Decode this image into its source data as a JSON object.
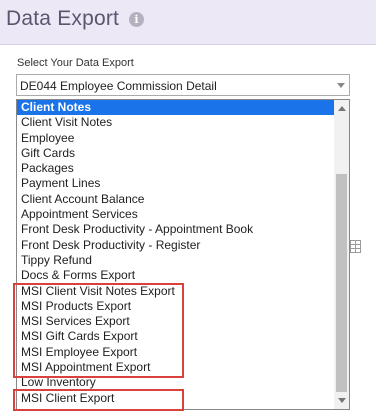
{
  "header": {
    "title": "Data Export",
    "info_icon": "info-icon"
  },
  "export_select": {
    "label": "Select Your Data Export",
    "value": "DE044 Employee Commission Detail"
  },
  "dropdown": {
    "selected_index": 0,
    "scroll_position": 0.25,
    "options": [
      "Client Notes",
      "Client Visit Notes",
      "Employee",
      "Gift Cards",
      "Packages",
      "Payment Lines",
      "Client Account Balance",
      "Appointment Services",
      "Front Desk Productivity - Appointment Book",
      "Front Desk Productivity - Register",
      "Tippy Refund",
      "Docs & Forms Export",
      "MSI Client Visit Notes Export",
      "MSI Products Export",
      "MSI Services Export",
      "MSI Gift Cards Export",
      "MSI Employee Export",
      "MSI Appointment Export",
      "Low Inventory",
      "MSI Client Export"
    ]
  },
  "colors": {
    "header_bg": "#ede8f5",
    "selected_bg": "#1a73e8",
    "highlight_border": "#d9423a"
  }
}
